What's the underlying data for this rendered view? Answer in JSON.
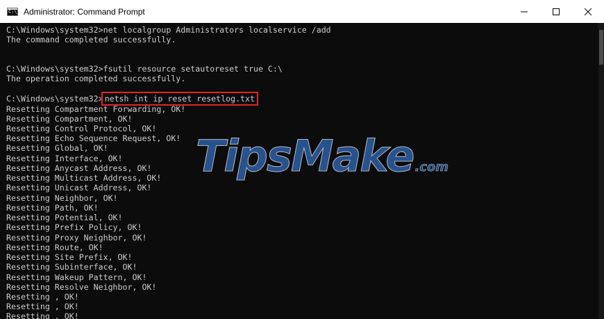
{
  "window": {
    "title": "Administrator: Command Prompt",
    "icon_label": "C:\\",
    "icons": {
      "app": "cmd-app-icon",
      "minimize": "minimize-icon",
      "maximize": "maximize-icon",
      "close": "close-icon"
    }
  },
  "terminal": {
    "lines": [
      "C:\\Windows\\system32>net localgroup Administrators localservice /add",
      "The command completed successfully.",
      "",
      "",
      "C:\\Windows\\system32>fsutil resource setautoreset true C:\\",
      "The operation completed successfully.",
      "",
      "C:\\Windows\\system32>",
      "Resetting Compartment Forwarding, OK!",
      "Resetting Compartment, OK!",
      "Resetting Control Protocol, OK!",
      "Resetting Echo Sequence Request, OK!",
      "Resetting Global, OK!",
      "Resetting Interface, OK!",
      "Resetting Anycast Address, OK!",
      "Resetting Multicast Address, OK!",
      "Resetting Unicast Address, OK!",
      "Resetting Neighbor, OK!",
      "Resetting Path, OK!",
      "Resetting Potential, OK!",
      "Resetting Prefix Policy, OK!",
      "Resetting Proxy Neighbor, OK!",
      "Resetting Route, OK!",
      "Resetting Site Prefix, OK!",
      "Resetting Subinterface, OK!",
      "Resetting Wakeup Pattern, OK!",
      "Resetting Resolve Neighbor, OK!",
      "Resetting , OK!",
      "Resetting , OK!",
      "Resetting , OK!"
    ],
    "highlighted_command": "netsh int ip reset resetlog.txt"
  },
  "watermark": {
    "main": "TipsMake",
    "suffix": ".com"
  },
  "colors": {
    "terminal_bg": "#0c0c0c",
    "terminal_text": "#cccccc",
    "highlight_box": "#e8202a",
    "watermark_blue": "#2f66b3"
  }
}
